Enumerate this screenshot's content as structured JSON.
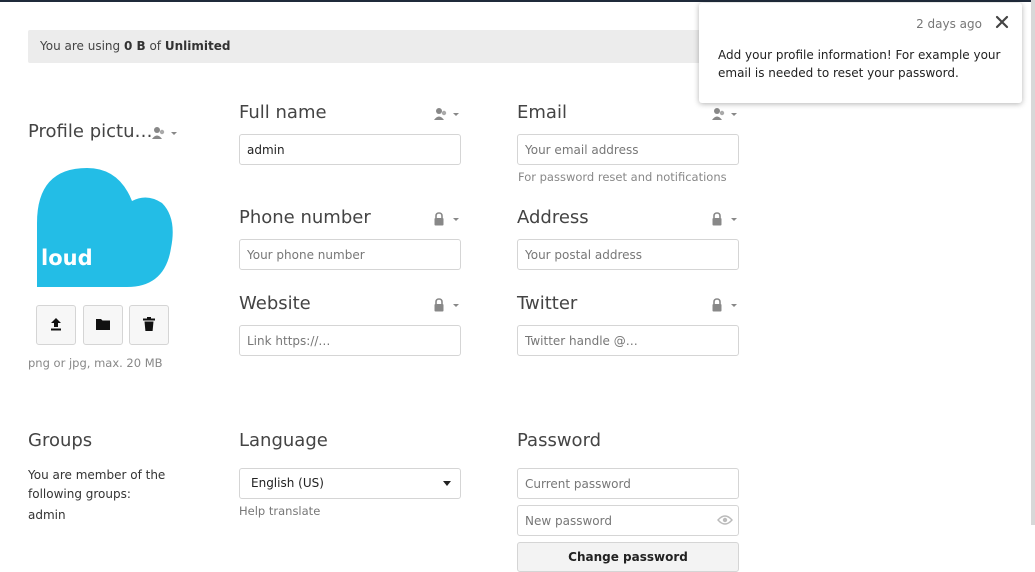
{
  "quota": {
    "prefix": "You are using ",
    "used": "0 B",
    "mid": " of ",
    "total": "Unlimited"
  },
  "profile_picture": {
    "title": "Profile pictu…",
    "avatar_text": "loud",
    "upload_icon": "upload-icon",
    "folder_icon": "folder-icon",
    "delete_icon": "trash-icon",
    "hint": "png or jpg, max. 20 MB"
  },
  "fields": {
    "full_name": {
      "label": "Full name",
      "value": "admin",
      "placeholder": "",
      "scope_icon": "contacts-scope-icon"
    },
    "email": {
      "label": "Email",
      "value": "",
      "placeholder": "Your email address",
      "hint": "For password reset and notifications",
      "scope_icon": "contacts-scope-icon"
    },
    "phone": {
      "label": "Phone number",
      "value": "",
      "placeholder": "Your phone number",
      "scope_icon": "lock-icon"
    },
    "address": {
      "label": "Address",
      "value": "",
      "placeholder": "Your postal address",
      "scope_icon": "lock-icon"
    },
    "website": {
      "label": "Website",
      "value": "",
      "placeholder": "Link https://…",
      "scope_icon": "lock-icon"
    },
    "twitter": {
      "label": "Twitter",
      "value": "",
      "placeholder": "Twitter handle @…",
      "scope_icon": "lock-icon"
    }
  },
  "groups": {
    "title": "Groups",
    "description": "You are member of the following groups:",
    "list": [
      "admin"
    ]
  },
  "language": {
    "title": "Language",
    "selected": "English (US)",
    "help_link": "Help translate"
  },
  "password": {
    "title": "Password",
    "current_placeholder": "Current password",
    "new_placeholder": "New password",
    "show_icon": "eye-icon",
    "change_button": "Change password"
  },
  "notification": {
    "time": "2 days ago",
    "message": "Add your profile information! For example your email is needed to reset your password.",
    "close_icon": "close-icon"
  },
  "colors": {
    "avatar": "#23bde6",
    "topbar": "#1f2a3a",
    "quota_bg": "#ececec"
  }
}
